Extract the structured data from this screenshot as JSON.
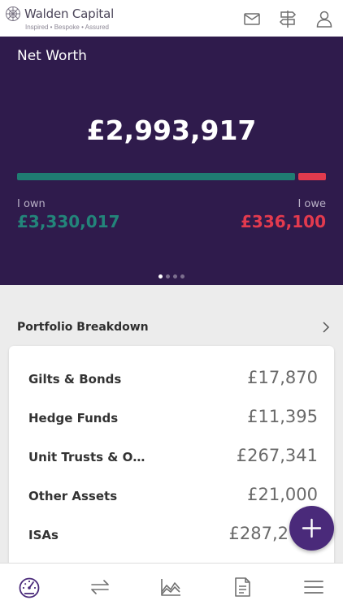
{
  "header": {
    "brand_name": "Walden Capital",
    "tagline": "Inspired • Bespoke • Assured",
    "icons": [
      "logo-icon",
      "mail-icon",
      "signpost-icon",
      "user-icon"
    ]
  },
  "net_worth": {
    "title": "Net Worth",
    "total": "£2,993,917",
    "own_label": "I own",
    "own_value": "£3,330,017",
    "owe_label": "I owe",
    "owe_value": "£336,100",
    "own_share": 0.908,
    "owe_share": 0.092,
    "carousel_pages": 4,
    "carousel_active": 0,
    "colors": {
      "panel": "#2f1b4c",
      "own": "#1f7c72",
      "owe": "#e13a4d"
    }
  },
  "portfolio": {
    "title": "Portfolio Breakdown",
    "rows": [
      {
        "label": "Gilts & Bonds",
        "value": "£17,870"
      },
      {
        "label": "Hedge Funds",
        "value": "£11,395"
      },
      {
        "label": "Unit Trusts & O…",
        "value": "£267,341"
      },
      {
        "label": "Other Assets",
        "value": "£21,000"
      },
      {
        "label": "ISAs",
        "value": "£287,2"
      }
    ]
  },
  "fab": {
    "icon": "plus-icon",
    "color": "#4a2a7a"
  },
  "bottom_nav": {
    "items": [
      "dashboard-gauge-icon",
      "transfer-arrows-icon",
      "area-chart-icon",
      "document-icon",
      "menu-icon"
    ],
    "active": 0,
    "active_color": "#4a2a7a"
  }
}
